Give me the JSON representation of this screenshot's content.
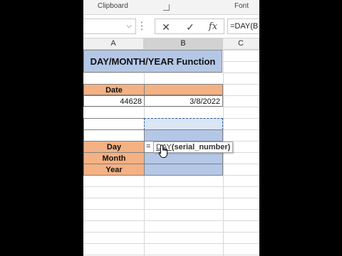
{
  "ribbon": {
    "clipboard_label": "Clipboard",
    "font_label": "Font"
  },
  "formula_bar": {
    "formula": "=DAY(B",
    "cancel_icon": "cancel-icon",
    "enter_icon": "checkmark-icon",
    "function_icon": "fx-icon",
    "fx_label": "fx"
  },
  "columns": [
    "A",
    "B",
    "C"
  ],
  "sheet": {
    "title": "DAY/MONTH/YEAR Function",
    "date_header": "Date",
    "serial_value": "44628",
    "date_value": "3/8/2022",
    "labels": {
      "day": "Day",
      "month": "Month",
      "year": "Year"
    },
    "editing_text": "="
  },
  "tooltip": {
    "function_name": "DAY",
    "argument": "(serial_number)"
  },
  "colors": {
    "title_fill": "#b4c7e7",
    "label_fill": "#f4b183",
    "result_fill": "#b4c7e7"
  }
}
